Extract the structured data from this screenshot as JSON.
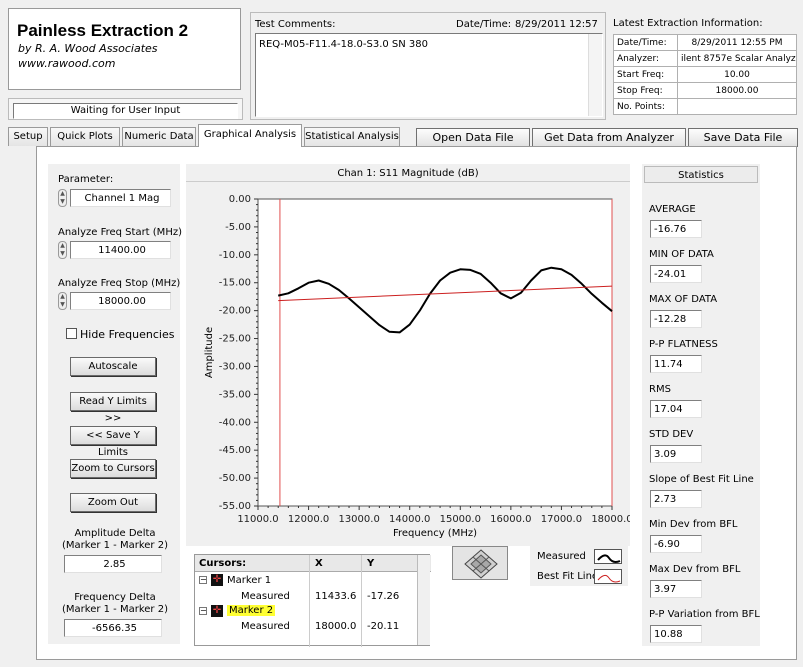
{
  "app": {
    "title": "Painless Extraction 2",
    "company": "by R. A. Wood Associates",
    "website": "www.rawood.com",
    "status": "Waiting for User Input"
  },
  "header": {
    "test_comments_label": "Test Comments:",
    "test_comments_value": "REQ-M05-F11.4-18.0-S3.0 SN 380",
    "datetime_label": "Date/Time:",
    "datetime_date": "8/29/2011",
    "datetime_time": "12:57",
    "latest_label": "Latest Extraction Information:",
    "latest": [
      {
        "key": "Date/Time:",
        "value": "8/29/2011   12:55 PM"
      },
      {
        "key": "Analyzer:",
        "value": "ilent 8757e Scalar Analyz"
      },
      {
        "key": "Start Freq:",
        "value": "10.00"
      },
      {
        "key": "Stop Freq:",
        "value": "18000.00"
      },
      {
        "key": "No. Points:",
        "value": ""
      }
    ]
  },
  "tabs": [
    "Setup",
    "Quick Plots",
    "Numeric Data",
    "Graphical Analysis",
    "Statistical Analysis"
  ],
  "actions": {
    "open": "Open Data File",
    "get": "Get Data from Analyzer",
    "save": "Save Data File"
  },
  "left": {
    "parameter_label": "Parameter:",
    "parameter_value": "Channel 1 Mag",
    "freq_start_label": "Analyze Freq Start (MHz)",
    "freq_start_value": "11400.00",
    "freq_stop_label": "Analyze Freq Stop (MHz)",
    "freq_stop_value": "18000.00",
    "hide_freq_label": "Hide Frequencies",
    "autoscale": "Autoscale",
    "read_y": "Read Y Limits >>",
    "save_y": "<< Save Y Limits",
    "zoom_cursors": "Zoom to Cursors",
    "zoom_out": "Zoom Out",
    "amp_delta_label1": "Amplitude Delta",
    "amp_delta_label2": "(Marker 1 - Marker 2)",
    "amp_delta_value": "2.85",
    "freq_delta_label1": "Frequency Delta",
    "freq_delta_label2": "(Marker 1 - Marker 2)",
    "freq_delta_value": "-6566.35"
  },
  "cursors": {
    "header": "Cursors:",
    "col_x": "X",
    "col_y": "Y",
    "rows": [
      {
        "name": "Marker 1",
        "sub": "Measured",
        "x": "11433.6",
        "y": "-17.26"
      },
      {
        "name": "Marker 2",
        "sub": "Measured",
        "x": "18000.0",
        "y": "-20.11"
      }
    ]
  },
  "legend": {
    "measured": "Measured",
    "bestfit": "Best Fit Line"
  },
  "stats": {
    "title": "Statistics",
    "items": [
      {
        "label": "AVERAGE",
        "value": "-16.76"
      },
      {
        "label": "MIN OF DATA",
        "value": "-24.01"
      },
      {
        "label": "MAX OF DATA",
        "value": "-12.28"
      },
      {
        "label": "P-P FLATNESS",
        "value": "11.74"
      },
      {
        "label": "RMS",
        "value": "17.04"
      },
      {
        "label": "STD DEV",
        "value": "3.09"
      },
      {
        "label": "Slope of Best Fit Line",
        "value": "2.73"
      },
      {
        "label": "Min Dev from BFL",
        "value": "-6.90"
      },
      {
        "label": "Max Dev from BFL",
        "value": "3.97"
      },
      {
        "label": "P-P Variation from BFL",
        "value": "10.88"
      }
    ]
  },
  "colors": {
    "measured": "#000000",
    "bestfit": "#cc2020",
    "cursor": "#e05050",
    "highlight": "#ffff33"
  },
  "chart_data": {
    "type": "line",
    "title": "Chan 1: S11 Magnitude (dB)",
    "xlabel": "Frequency (MHz)",
    "ylabel": "Amplitude",
    "xlim": [
      11000,
      18000
    ],
    "ylim": [
      -55,
      0
    ],
    "x_ticks": [
      "11000.0",
      "12000.0",
      "13000.0",
      "14000.0",
      "15000.0",
      "16000.0",
      "17000.0",
      "18000.0"
    ],
    "y_ticks": [
      "0.00",
      "-5.00",
      "-10.00",
      "-15.00",
      "-20.00",
      "-25.00",
      "-30.00",
      "-35.00",
      "-40.00",
      "-45.00",
      "-50.00",
      "-55.00"
    ],
    "series": [
      {
        "name": "Measured",
        "x": [
          11400,
          11600,
          11800,
          12000,
          12200,
          12400,
          12600,
          12800,
          13000,
          13200,
          13400,
          13600,
          13800,
          14000,
          14200,
          14400,
          14600,
          14800,
          15000,
          15200,
          15400,
          15600,
          15800,
          16000,
          16200,
          16400,
          16600,
          16800,
          17000,
          17200,
          17400,
          17600,
          17800,
          18000
        ],
        "y": [
          -17.3,
          -16.9,
          -16.0,
          -15.0,
          -14.6,
          -15.2,
          -16.3,
          -17.8,
          -19.4,
          -21.0,
          -22.6,
          -23.8,
          -23.9,
          -22.5,
          -20.0,
          -17.0,
          -14.6,
          -13.2,
          -12.6,
          -12.7,
          -13.4,
          -15.0,
          -16.9,
          -17.8,
          -16.8,
          -14.6,
          -12.8,
          -12.3,
          -12.6,
          -13.6,
          -15.2,
          -17.0,
          -18.6,
          -20.1
        ]
      },
      {
        "name": "Best Fit Line",
        "x": [
          11400,
          18000
        ],
        "y": [
          -18.2,
          -15.6
        ]
      }
    ],
    "markers": [
      11433.6,
      18000.0
    ],
    "grid": false
  }
}
